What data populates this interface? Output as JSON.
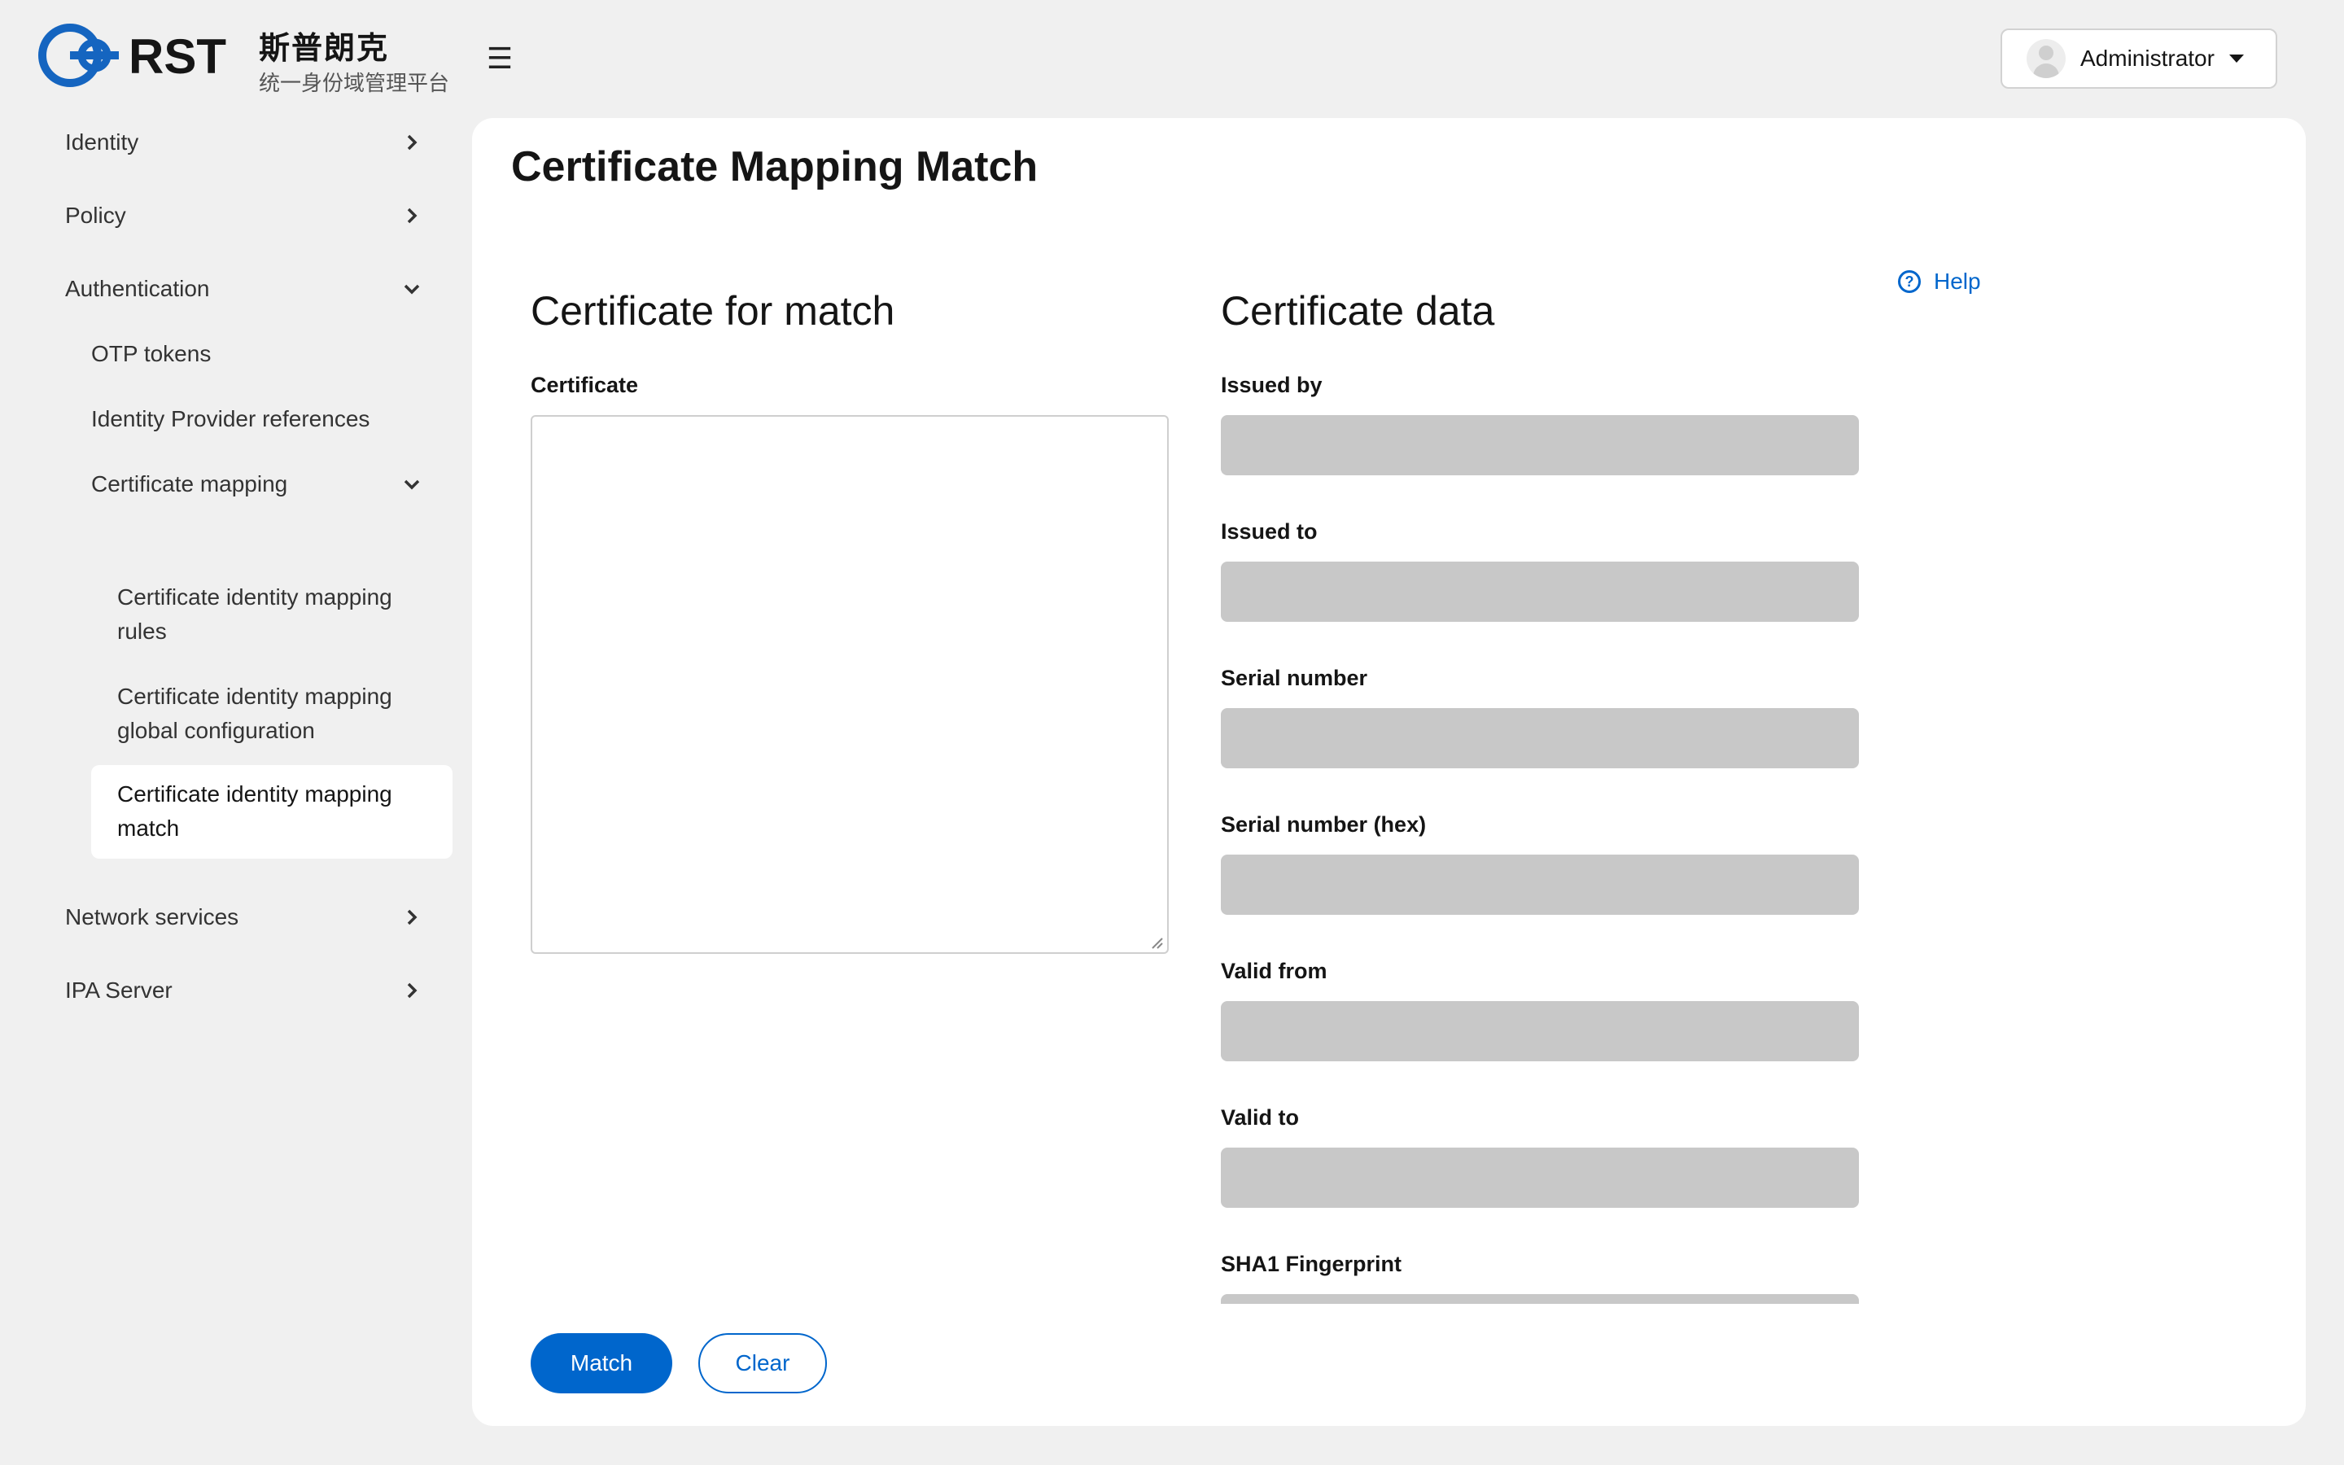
{
  "header": {
    "logo_text": "RST",
    "brand_name": "斯普朗克",
    "brand_subtitle": "统一身份域管理平台",
    "menu_toggle_icon": "hamburger-icon",
    "user": {
      "name": "Administrator",
      "avatar_icon": "user-avatar-icon"
    }
  },
  "sidebar": {
    "items": [
      {
        "label": "Identity",
        "icon": "chevron-right-icon"
      },
      {
        "label": "Policy",
        "icon": "chevron-right-icon"
      },
      {
        "label": "Authentication",
        "icon": "chevron-down-icon"
      },
      {
        "label": "OTP tokens"
      },
      {
        "label": "Identity Provider references"
      },
      {
        "label": "Certificate mapping",
        "icon": "chevron-down-icon"
      },
      {
        "label": "Certificate identity mapping rules"
      },
      {
        "label": "Certificate identity mapping global configuration"
      },
      {
        "label": "Certificate identity mapping match",
        "active": true
      },
      {
        "label": "Network services",
        "icon": "chevron-right-icon"
      },
      {
        "label": "IPA Server",
        "icon": "chevron-right-icon"
      }
    ]
  },
  "main": {
    "title": "Certificate Mapping Match",
    "help_label": "Help",
    "left_section": {
      "title": "Certificate for match",
      "certificate_label": "Certificate",
      "certificate_value": ""
    },
    "right_section": {
      "title": "Certificate data",
      "fields": [
        {
          "label": "Issued by",
          "value": ""
        },
        {
          "label": "Issued to",
          "value": ""
        },
        {
          "label": "Serial number",
          "value": ""
        },
        {
          "label": "Serial number (hex)",
          "value": ""
        },
        {
          "label": "Valid from",
          "value": ""
        },
        {
          "label": "Valid to",
          "value": ""
        },
        {
          "label": "SHA1 Fingerprint",
          "value": ""
        }
      ]
    },
    "buttons": {
      "match": "Match",
      "clear": "Clear"
    }
  },
  "colors": {
    "accent": "#0066cc",
    "readonly_field": "#c8c8c8",
    "background": "#f0f0f0"
  }
}
